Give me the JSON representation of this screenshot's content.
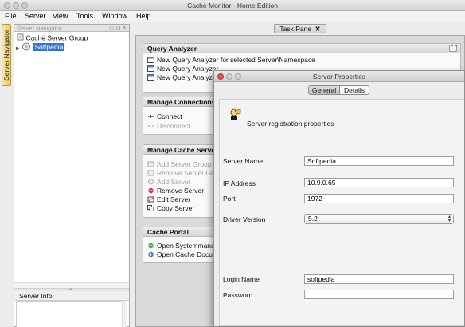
{
  "window": {
    "title": "Caché Monitor - Home Edition"
  },
  "menu": [
    "File",
    "Server",
    "View",
    "Tools",
    "Window",
    "Help"
  ],
  "sidebar_tab": "Server Navigator",
  "navigator": {
    "title": "Server Navigator",
    "tree": {
      "group": "Caché Server Group",
      "server": "Softpedia"
    }
  },
  "server_info": {
    "title": "Server Info"
  },
  "task_pane": {
    "tab_label": "Task Pane",
    "close_glyph": "✕"
  },
  "sections": {
    "query": {
      "title": "Query Analyzer",
      "items": [
        "New Query Analyzer for selected Server\\Namespace",
        "New Query Analyzer",
        "New Query Analyzer"
      ]
    },
    "connections": {
      "title": "Manage Connections",
      "items": [
        "Connect",
        "Disconnect"
      ]
    },
    "servers": {
      "title": "Manage Caché Servers",
      "items": [
        "Add Server Group",
        "Remove Server Group",
        "Add Server",
        "Remove Server",
        "Edit Server",
        "Copy Server"
      ]
    },
    "portal": {
      "title": "Caché Portal",
      "items": [
        "Open Systemmanagement Portal",
        "Open Caché Documentation"
      ]
    }
  },
  "dialog": {
    "title": "Server Properties",
    "tabs": [
      "General",
      "Details"
    ],
    "heading": "Server registration properties",
    "fields": {
      "server_name": {
        "label": "Server Name",
        "value": "Softpedia"
      },
      "ip": {
        "label": "IP Address",
        "value": "10.9.0.65"
      },
      "port": {
        "label": "Port",
        "value": "1972"
      },
      "driver": {
        "label": "Driver Version",
        "value": "5.2"
      },
      "login": {
        "label": "Login Name",
        "value": "softpedia"
      },
      "password": {
        "label": "Password",
        "value": ""
      }
    }
  },
  "colors": {
    "selection": "#3874d8",
    "sidebar_tab": "#e8cc6a",
    "window_bg": "#ececec"
  }
}
